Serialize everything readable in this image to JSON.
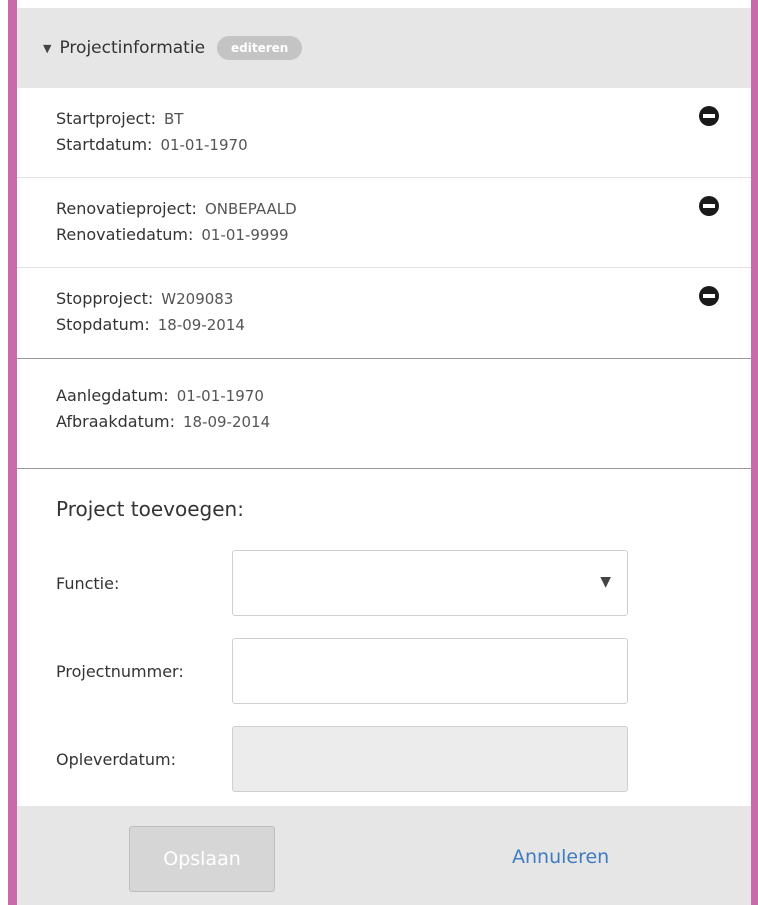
{
  "header": {
    "title": "Projectinformatie",
    "edit_label": "editeren",
    "caret": "▼"
  },
  "projects": [
    {
      "project_label": "Startproject:",
      "project_value": "BT",
      "date_label": "Startdatum:",
      "date_value": "01-01-1970"
    },
    {
      "project_label": "Renovatieproject:",
      "project_value": "ONBEPAALD",
      "date_label": "Renovatiedatum:",
      "date_value": "01-01-9999"
    },
    {
      "project_label": "Stopproject:",
      "project_value": "W209083",
      "date_label": "Stopdatum:",
      "date_value": "18-09-2014"
    }
  ],
  "dates": {
    "aanleg_label": "Aanlegdatum:",
    "aanleg_value": "01-01-1970",
    "afbraak_label": "Afbraakdatum:",
    "afbraak_value": "18-09-2014"
  },
  "add_project": {
    "title": "Project toevoegen:",
    "function_label": "Functie:",
    "function_value": "",
    "dropdown_arrow": "▼",
    "project_number_label": "Projectnummer:",
    "project_number_value": "",
    "delivery_date_label": "Opleverdatum:",
    "delivery_date_value": ""
  },
  "footer": {
    "save_label": "Opslaan",
    "cancel_label": "Annuleren"
  },
  "colors": {
    "accent": "#c86ba8",
    "link": "#3f7cc0",
    "header_bg": "#e6e6e6"
  },
  "icons": {
    "remove": "minus-circle-icon",
    "collapse": "caret-down-icon"
  }
}
